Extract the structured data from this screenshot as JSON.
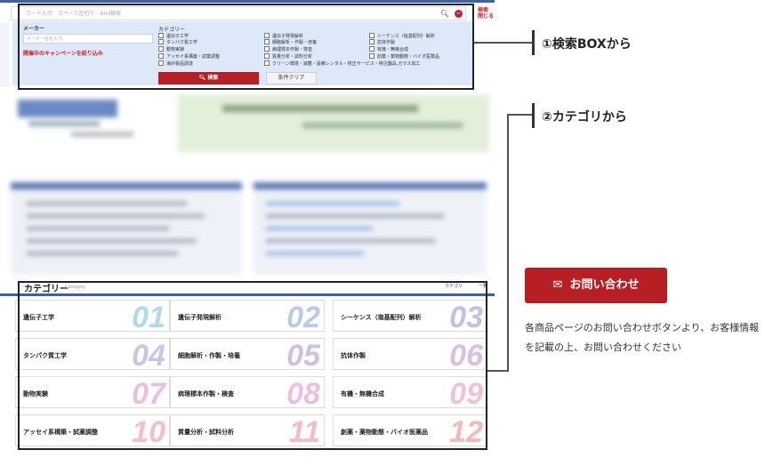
{
  "search_panel": {
    "search_placeholder": "ワード入力　スペース区切り　And検索",
    "close_label": "検索\n閉じる",
    "maker_heading": "メーカー",
    "maker_placeholder": "メーカー名を入力",
    "campaign_link": "開催中のキャンペーンを絞り込み",
    "category_heading": "カテゴリー",
    "categories": [
      "遺伝子工学",
      "タンパク質工学",
      "動物実験",
      "アッセイ系構築・試薬調整",
      "海外製品調達",
      "遺伝子発現解析",
      "細胞解析・作製・培養",
      "病理標本作製・検査",
      "質量分析・試料分析",
      "クリーン環境・滅菌・設備レンタル・校正サービス・特注器具,ガラス加工",
      "シーケンス（塩基配列）解析",
      "抗体作製",
      "有機・無機合成",
      "創薬・薬物動態・バイオ医薬品"
    ],
    "search_button": "検索",
    "clear_button": "条件クリア"
  },
  "callouts": {
    "c1": "①検索BOXから",
    "c2": "②カテゴリから"
  },
  "category_section": {
    "title": "カテゴリー",
    "title_en": "Category",
    "toggle": "カテゴリ",
    "list_label": "一覧",
    "tiles": [
      {
        "label": "遺伝子工学",
        "num": "01",
        "color": "#8ecbe6"
      },
      {
        "label": "遺伝子発現解析",
        "num": "02",
        "color": "#9fb4e0"
      },
      {
        "label": "シーケンス（塩基配列）解析",
        "num": "03",
        "color": "#a9a6d6"
      },
      {
        "label": "タンパク質工学",
        "num": "04",
        "color": "#aeb1d8"
      },
      {
        "label": "細胞解析・作製・培養",
        "num": "05",
        "color": "#bba6d8"
      },
      {
        "label": "抗体作製",
        "num": "06",
        "color": "#c7a6d6"
      },
      {
        "label": "動物実験",
        "num": "07",
        "color": "#d9a6d8"
      },
      {
        "label": "病理標本作製・検査",
        "num": "08",
        "color": "#e3a4d2"
      },
      {
        "label": "有機・無機合成",
        "num": "09",
        "color": "#eaa6c8"
      },
      {
        "label": "アッセイ系構築・試薬調整",
        "num": "10",
        "color": "#f0a4b8"
      },
      {
        "label": "質量分析・試料分析",
        "num": "11",
        "color": "#f2a0ae"
      },
      {
        "label": "創薬・薬物動態・バイオ医薬品",
        "num": "12",
        "color": "#f39c9c"
      }
    ]
  },
  "contact": {
    "button": "お問い合わせ",
    "note": "各商品ページのお問い合わせボタンより、お客様情報を記載の上、お問い合わせください"
  }
}
